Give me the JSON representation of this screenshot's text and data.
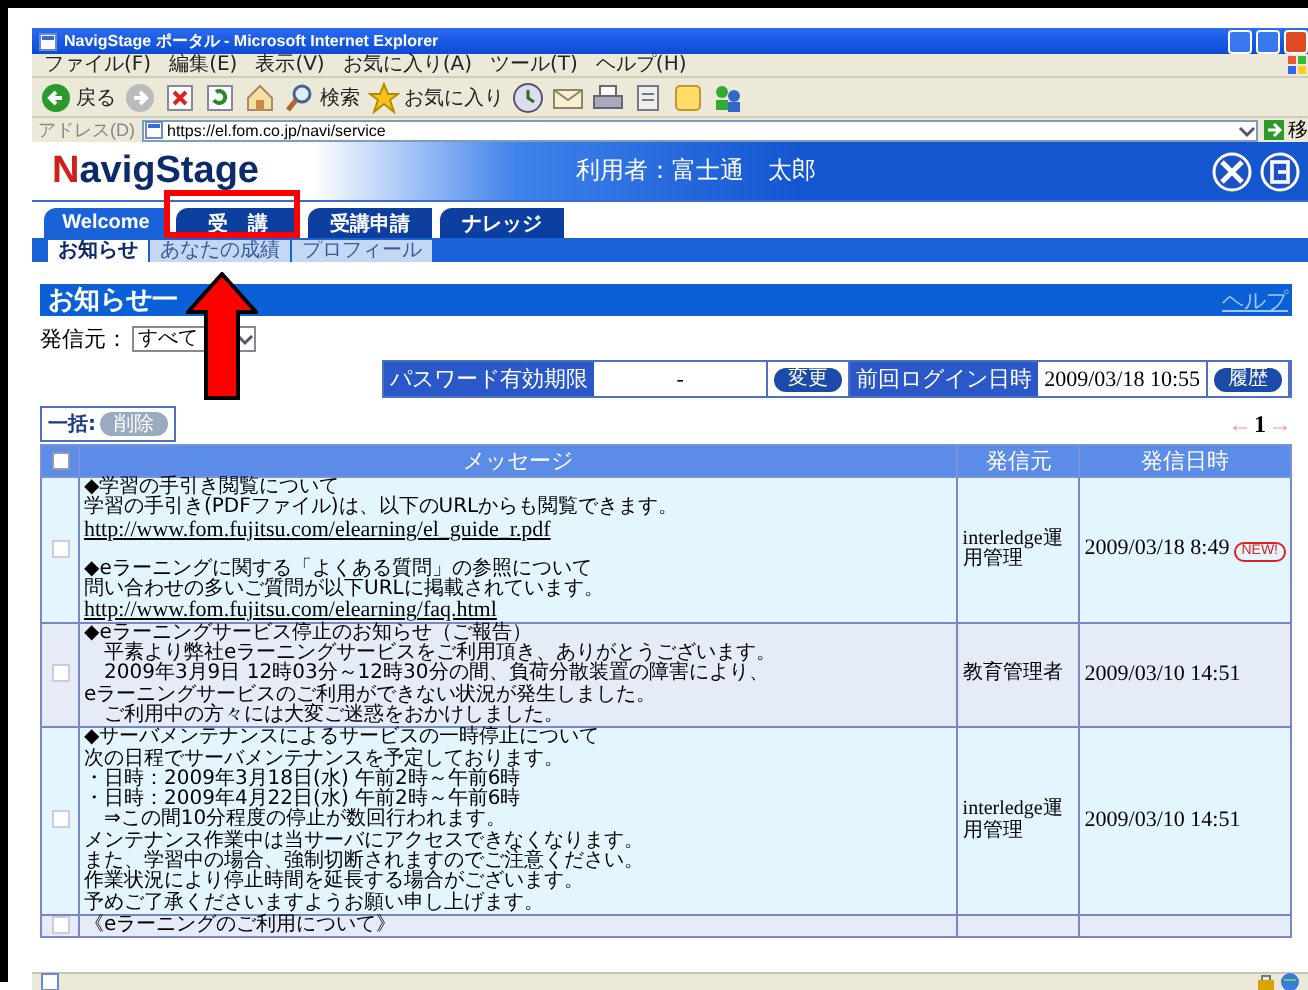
{
  "browser": {
    "title": "NavigStage ポータル - Microsoft Internet Explorer",
    "menu": [
      "ファイル(F)",
      "編集(E)",
      "表示(V)",
      "お気に入り(A)",
      "ツール(T)",
      "ヘルプ(H)"
    ],
    "toolbar": [
      {
        "kind": "back",
        "label": "戻る"
      },
      {
        "kind": "forward"
      },
      {
        "kind": "stop"
      },
      {
        "kind": "refresh"
      },
      {
        "kind": "home"
      },
      {
        "kind": "search",
        "label": "検索"
      },
      {
        "kind": "favorites",
        "label": "お気に入り"
      },
      {
        "kind": "history"
      },
      {
        "kind": "mail"
      },
      {
        "kind": "print"
      },
      {
        "kind": "edit"
      },
      {
        "kind": "note"
      },
      {
        "kind": "people"
      }
    ],
    "address": {
      "label": "アドレス(D)",
      "url": "https://el.fom.co.jp/navi/service",
      "go": "移"
    }
  },
  "header": {
    "logo": "NavigStage",
    "user": "利用者：富士通　太郎"
  },
  "tabs": [
    {
      "label": "Welcome",
      "selected": true
    },
    {
      "label": "受　講",
      "selected": false
    },
    {
      "label": "受講申請",
      "selected": false
    },
    {
      "label": "ナレッジ",
      "selected": false
    }
  ],
  "subtabs": [
    {
      "label": "お知らせ",
      "selected": true
    },
    {
      "label": "あなたの成績",
      "selected": false
    },
    {
      "label": "プロフィール",
      "selected": false
    }
  ],
  "section": {
    "title": "お知らせ一",
    "help": "ヘルプ"
  },
  "filter": {
    "label": "発信元：",
    "value": "すべて"
  },
  "login_info": {
    "password_label": "パスワード有効期限",
    "password_value": "-",
    "change_button": "変更",
    "last_login_label": "前回ログイン日時",
    "last_login": "2009/03/18 10:55",
    "history_button": "履歴"
  },
  "bulk": {
    "label": "一括:",
    "delete_button": "削除",
    "disabled": true
  },
  "pager": {
    "prev": "←",
    "page": "1",
    "next": "→"
  },
  "table": {
    "select_all_checked": false,
    "columns": [
      "メッセージ",
      "発信元",
      "発信日時"
    ],
    "rows": [
      {
        "checked": false,
        "paragraphs": [
          [
            {
              "text": "◆学習の手引き閲覧について",
              "link": false
            },
            {
              "text": "学習の手引き(PDFファイル)は、以下のURLからも閲覧できます。",
              "link": false
            },
            {
              "text": "http://www.fom.fujitsu.com/elearning/el_guide_r.pdf",
              "link": true
            }
          ],
          [
            {
              "text": "◆eラーニングに関する「よくある質問」の参照について",
              "link": false
            },
            {
              "text": "問い合わせの多いご質問が以下URLに掲載されています。",
              "link": false
            },
            {
              "text": "http://www.fom.fujitsu.com/elearning/faq.html",
              "link": true
            }
          ]
        ],
        "sender": "interledge運用管理",
        "date": "2009/03/18 8:49",
        "badge": "NEW!"
      },
      {
        "checked": false,
        "paragraphs": [
          [
            {
              "text": "◆eラーニングサービス停止のお知らせ（ご報告）",
              "link": false
            },
            {
              "text": "　平素より弊社eラーニングサービスをご利用頂き、ありがとうございます。",
              "link": false
            },
            {
              "text": "　2009年3月9日 12時03分～12時30分の間、負荷分散装置の障害により、",
              "link": false
            },
            {
              "text": "eラーニングサービスのご利用ができない状況が発生しました。",
              "link": false
            },
            {
              "text": "　ご利用中の方々には大変ご迷惑をおかけしました。",
              "link": false
            }
          ]
        ],
        "sender": "教育管理者",
        "date": "2009/03/10 14:51"
      },
      {
        "checked": false,
        "paragraphs": [
          [
            {
              "text": "◆サーバメンテナンスによるサービスの一時停止について",
              "link": false
            },
            {
              "text": "次の日程でサーバメンテナンスを予定しております。",
              "link": false
            },
            {
              "text": "・日時：2009年3月18日(水) 午前2時～午前6時",
              "link": false
            },
            {
              "text": "・日時：2009年4月22日(水) 午前2時～午前6時",
              "link": false
            },
            {
              "text": "　⇒この間10分程度の停止が数回行われます。",
              "link": false
            },
            {
              "text": "メンテナンス作業中は当サーバにアクセスできなくなります。",
              "link": false
            },
            {
              "text": "また、学習中の場合、強制切断されますのでご注意ください。",
              "link": false
            },
            {
              "text": "作業状況により停止時間を延長する場合がございます。",
              "link": false
            },
            {
              "text": "予めご了承くださいますようお願い申し上げます。",
              "link": false
            }
          ]
        ],
        "sender": "interledge運用管理",
        "date": "2009/03/10 14:51"
      },
      {
        "checked": false,
        "paragraphs": [
          [
            {
              "text": "《eラーニングのご利用について》",
              "link": false
            }
          ]
        ]
      }
    ]
  }
}
